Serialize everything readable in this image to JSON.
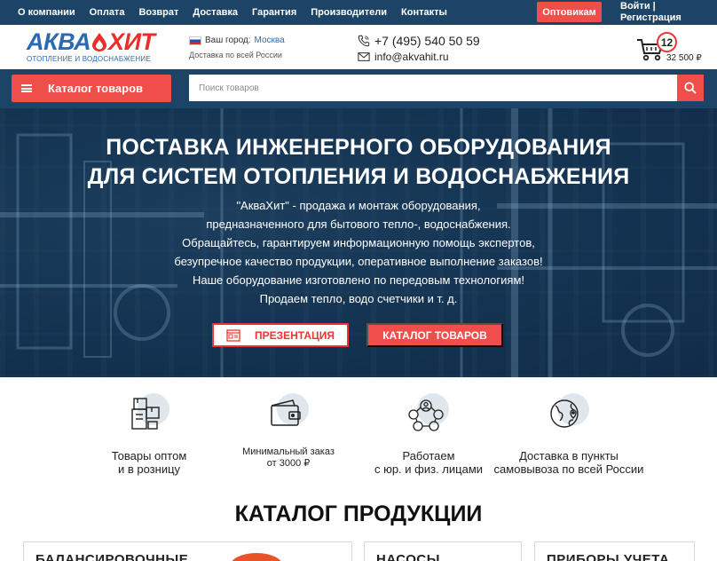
{
  "topnav": {
    "items": [
      "О компании",
      "Оплата",
      "Возврат",
      "Доставка",
      "Гарантия",
      "Производители",
      "Контакты"
    ],
    "wholesale_button": "Оптовикам",
    "login": "Войти |",
    "register": "Регистрация"
  },
  "header": {
    "logo": {
      "part1": "АКВА",
      "part2": "ХИТ",
      "tagline": "ОТОПЛЕНИЕ И ВОДОСНАБЖЕНИЕ"
    },
    "city_label": "Ваш город:",
    "city": "Москва",
    "delivery_note": "Доставка по всей России",
    "phone": "+7 (495) 540 50 59",
    "email": "info@akvahit.ru",
    "cart": {
      "count": "12",
      "total": "32 500 ₽"
    }
  },
  "search": {
    "catalog_button": "Каталог товаров",
    "placeholder": "Поиск товаров"
  },
  "hero": {
    "title_line1": "ПОСТАВКА ИНЖЕНЕРНОГО ОБОРУДОВАНИЯ",
    "title_line2": "ДЛЯ СИСТЕМ ОТОПЛЕНИЯ И ВОДОСНАБЖЕНИЯ",
    "text_lines": [
      "\"АкваХит\" - продажа и монтаж оборудования,",
      "предназначенного для бытового тепло-, водоснабжения.",
      "Обращайтесь, гарантируем информационную помощь экспертов,",
      "безупречное качество продукции, оперативное выполнение заказов!",
      "Наше оборудование изготовлено по передовым технологиям!",
      "Продаем тепло, водо счетчики и т. д."
    ],
    "presentation_button": "ПРЕЗЕНТАЦИЯ",
    "catalog_button": "КАТАЛОГ ТОВАРОВ"
  },
  "features": [
    {
      "line1": "Товары оптом",
      "line2": "и в розницу",
      "icon": "boxes-icon"
    },
    {
      "line1": "Минимальный заказ",
      "line2": "от 3000 ₽",
      "icon": "wallet-icon"
    },
    {
      "line1": "Работаем",
      "line2": "с юр. и физ. лицами",
      "icon": "people-network-icon"
    },
    {
      "line1": "Доставка в пункты",
      "line2": "самовывоза по всей России",
      "icon": "globe-pin-icon"
    }
  ],
  "catalog": {
    "heading": "КАТАЛОГ ПРОДУКЦИИ",
    "cards": [
      "БАЛАНСИРОВОЧНЫЕ",
      "НАСОСЫ",
      "ПРИБОРЫ УЧЕТА"
    ]
  },
  "colors": {
    "dark_blue": "#1c4466",
    "accent_red": "#f04e4a",
    "brand_blue": "#2a6ab3"
  }
}
